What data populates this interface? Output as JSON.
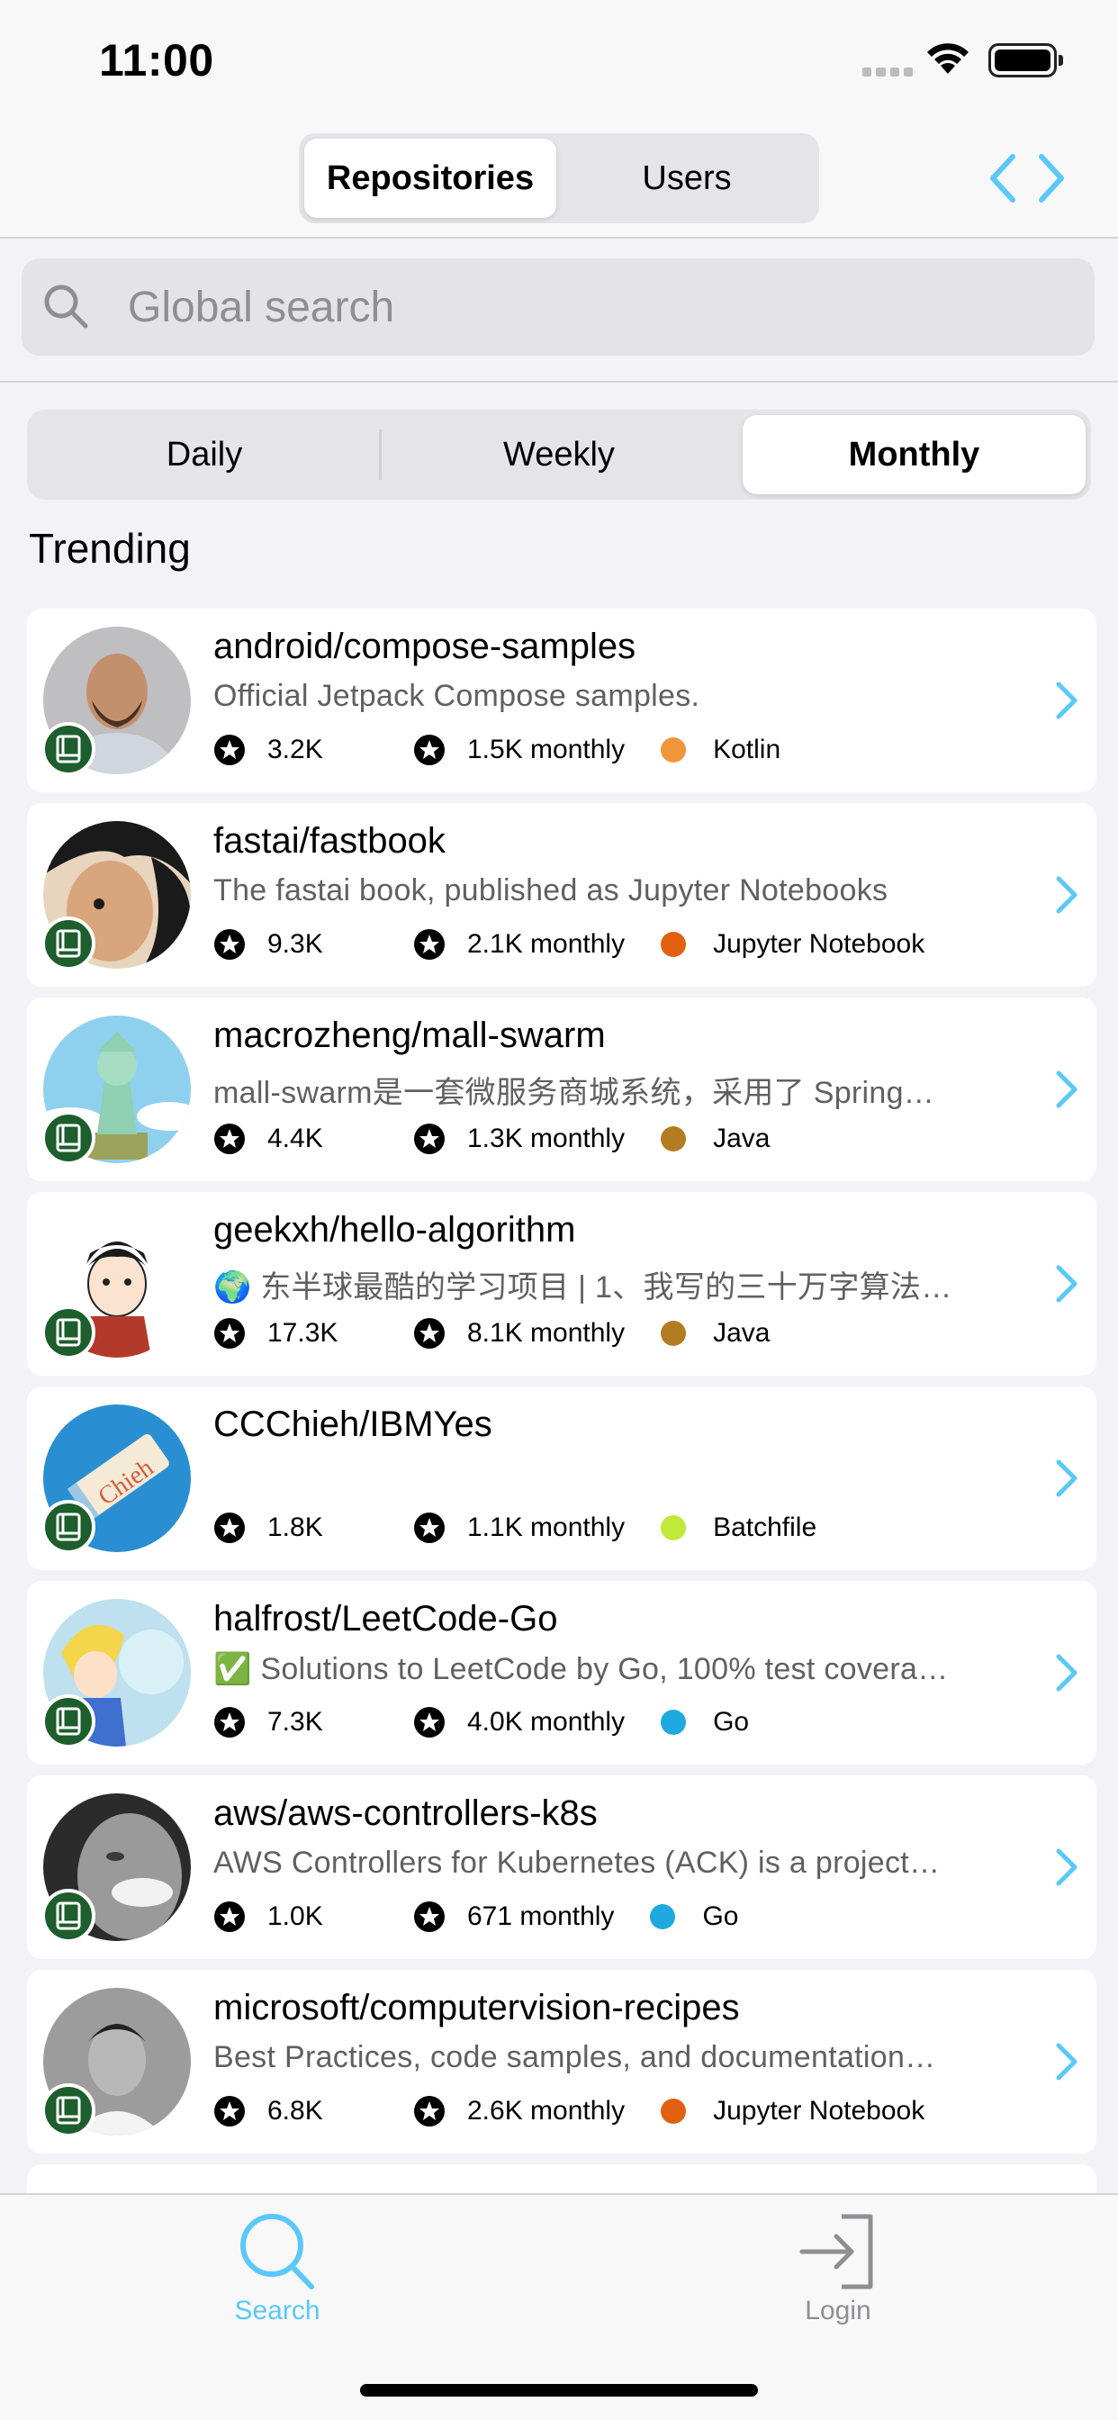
{
  "status_bar": {
    "time": "11:00"
  },
  "scope": {
    "tabs": [
      {
        "label": "Repositories"
      },
      {
        "label": "Users"
      }
    ],
    "selected": "Repositories"
  },
  "search": {
    "placeholder": "Global search",
    "value": ""
  },
  "period": {
    "options": [
      {
        "label": "Daily"
      },
      {
        "label": "Weekly"
      },
      {
        "label": "Monthly"
      }
    ],
    "selected": "Monthly"
  },
  "section_title": "Trending",
  "repos": [
    {
      "name": "android/compose-samples",
      "description": "Official Jetpack Compose samples.",
      "stars": "3.2K",
      "monthly": "1.5K monthly",
      "language": "Kotlin",
      "language_color": "#f0953a"
    },
    {
      "name": "fastai/fastbook",
      "description": "The fastai book, published as Jupyter Notebooks",
      "stars": "9.3K",
      "monthly": "2.1K monthly",
      "language": "Jupyter Notebook",
      "language_color": "#e2600f"
    },
    {
      "name": "macrozheng/mall-swarm",
      "description": "mall-swarm是一套微服务商城系统，采用了 Spring…",
      "stars": "4.4K",
      "monthly": "1.3K monthly",
      "language": "Java",
      "language_color": "#b27c22"
    },
    {
      "name": "geekxh/hello-algorithm",
      "description": "🌍 东半球最酷的学习项目 | 1、我写的三十万字算法…",
      "stars": "17.3K",
      "monthly": "8.1K monthly",
      "language": "Java",
      "language_color": "#b27c22"
    },
    {
      "name": "CCChieh/IBMYes",
      "description": "",
      "stars": "1.8K",
      "monthly": "1.1K monthly",
      "language": "Batchfile",
      "language_color": "#c1e93a"
    },
    {
      "name": "halfrost/LeetCode-Go",
      "description": "✅ Solutions to LeetCode by Go, 100% test covera…",
      "stars": "7.3K",
      "monthly": "4.0K monthly",
      "language": "Go",
      "language_color": "#1ea9df"
    },
    {
      "name": "aws/aws-controllers-k8s",
      "description": "AWS Controllers for Kubernetes (ACK) is a project…",
      "stars": "1.0K",
      "monthly": "671 monthly",
      "language": "Go",
      "language_color": "#1ea9df"
    },
    {
      "name": "microsoft/computervision-recipes",
      "description": "Best Practices, code samples, and documentation…",
      "stars": "6.8K",
      "monthly": "2.6K monthly",
      "language": "Jupyter Notebook",
      "language_color": "#e2600f"
    }
  ],
  "tab_bar": {
    "items": [
      {
        "label": "Search",
        "icon": "search-icon"
      },
      {
        "label": "Login",
        "icon": "login-icon"
      }
    ],
    "selected": "Search"
  },
  "colors": {
    "accent": "#5ac8fa",
    "badge": "#1d5e2c"
  }
}
